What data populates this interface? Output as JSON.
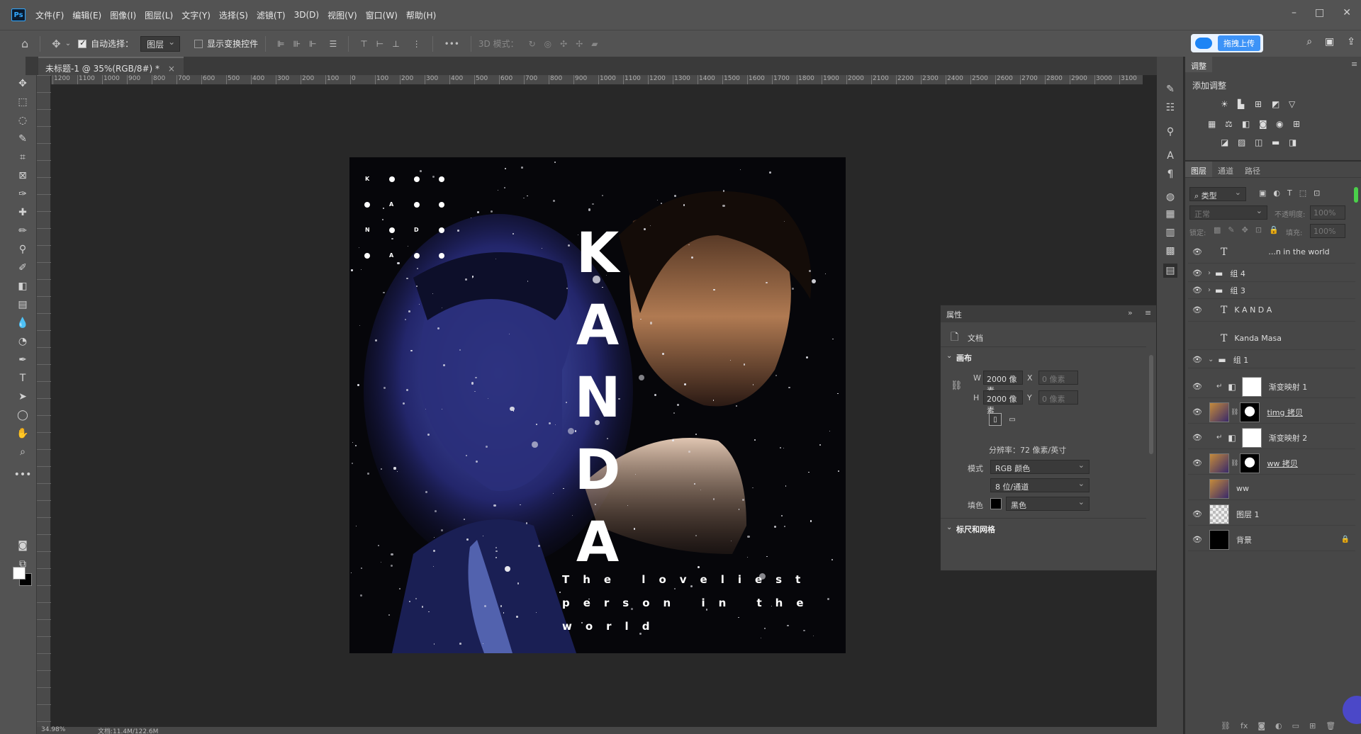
{
  "app": {
    "logo": "Ps"
  },
  "menu": [
    "文件(F)",
    "编辑(E)",
    "图像(I)",
    "图层(L)",
    "文字(Y)",
    "选择(S)",
    "滤镜(T)",
    "3D(D)",
    "视图(V)",
    "窗口(W)",
    "帮助(H)"
  ],
  "window_controls": [
    "–",
    "□",
    "✕"
  ],
  "options": {
    "auto_select_label": "自动选择：",
    "auto_select_target": "图层",
    "show_transform_label": "显示变换控件",
    "mode_3d_label": "3D 模式：",
    "upload_label": "拖拽上传"
  },
  "document_tab": {
    "title": "未标题-1 @ 35%(RGB/8#) *",
    "close": "×"
  },
  "ruler_top": [
    "1200",
    "1100",
    "1000",
    "900",
    "800",
    "700",
    "600",
    "500",
    "400",
    "300",
    "200",
    "100",
    "0",
    "100",
    "200",
    "300",
    "400",
    "500",
    "600",
    "700",
    "800",
    "900",
    "1000",
    "1100",
    "1200",
    "1300",
    "1400",
    "1500",
    "1600",
    "1700",
    "1800",
    "1900",
    "2000",
    "2100",
    "2200",
    "2300",
    "2400",
    "2500",
    "2600",
    "2700",
    "2800",
    "2900",
    "3000",
    "3100"
  ],
  "artwork": {
    "grid_letters": [
      "K",
      "A",
      "N",
      "D",
      "A"
    ],
    "big_letters": [
      "K",
      "A",
      "N",
      "D",
      "A"
    ],
    "tagline": [
      "The loveliest",
      "person in the",
      "world"
    ]
  },
  "adjustments": {
    "tab": "调整",
    "add_label": "添加调整"
  },
  "layers_panel": {
    "tabs": [
      "图层",
      "通道",
      "路径"
    ],
    "filter_kind": "类型",
    "blend_mode": "正常",
    "opacity_label": "不透明度:",
    "opacity_value": "100%",
    "lock_label": "锁定:",
    "fill_label": "填充:",
    "fill_value": "100%",
    "layers": [
      {
        "name": "...n in the  world",
        "kind": "text",
        "visible": true
      },
      {
        "name": "组 4",
        "kind": "group",
        "visible": true
      },
      {
        "name": "组 3",
        "kind": "group",
        "visible": true
      },
      {
        "name": "K A N D A",
        "kind": "text",
        "visible": true
      },
      {
        "name": "Kanda Masa",
        "kind": "text",
        "visible": false
      },
      {
        "name": "组 1",
        "kind": "group",
        "visible": true
      },
      {
        "name": "渐变映射 1",
        "kind": "adjustment",
        "visible": true
      },
      {
        "name": "timg 拷贝",
        "kind": "image",
        "visible": true
      },
      {
        "name": "渐变映射 2",
        "kind": "adjustment",
        "visible": true
      },
      {
        "name": "ww 拷贝",
        "kind": "image",
        "visible": true
      },
      {
        "name": "ww",
        "kind": "image",
        "visible": false
      },
      {
        "name": "图层 1",
        "kind": "empty",
        "visible": true
      },
      {
        "name": "背景",
        "kind": "background",
        "visible": true
      }
    ]
  },
  "properties": {
    "title": "属性",
    "doc_label": "文档",
    "canvas_section": "画布",
    "w_label": "W",
    "w_value": "2000 像素",
    "h_label": "H",
    "h_value": "2000 像素",
    "x_label": "X",
    "x_value": "0 像素",
    "y_label": "Y",
    "y_value": "0 像素",
    "resolution": "分辨率：72 像素/英寸",
    "mode_label": "模式",
    "mode_value": "RGB 颜色",
    "depth_value": "8 位/通道",
    "fill_label": "填色",
    "fill_value": "黑色",
    "rulers_section": "标尺和网格"
  },
  "status": {
    "zoom": "34.98%",
    "doc_size": "文档:11.4M/122.6M"
  },
  "colors": {
    "panel": "#474747",
    "toolbar": "#535353",
    "canvas_bg": "#282828",
    "accent": "#31a8ff"
  }
}
